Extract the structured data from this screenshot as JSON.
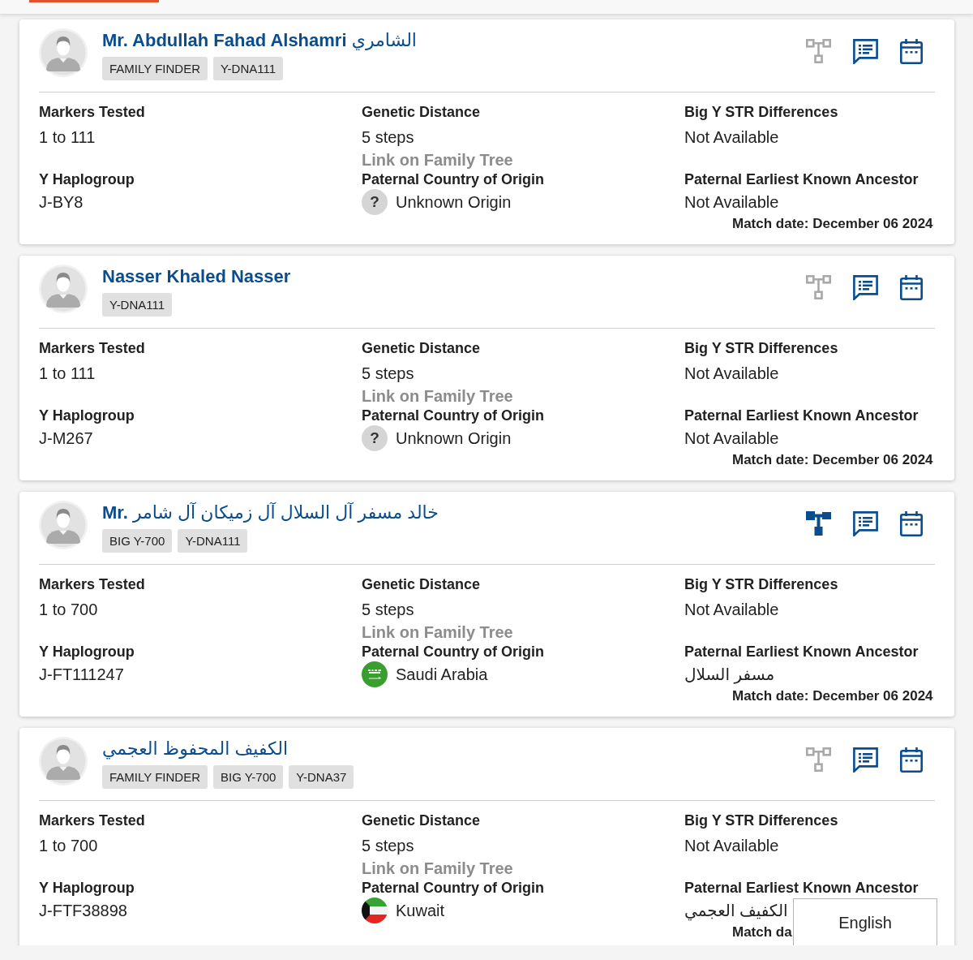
{
  "matches": [
    {
      "name_latin": "Mr. Abdullah Fahad Alshamri",
      "name_arabic": "الشامري",
      "tags": [
        "FAMILY FINDER",
        "Y-DNA111"
      ],
      "tree_available": false,
      "markers_tested": {
        "label": "Markers Tested",
        "value": "1 to 111"
      },
      "genetic_distance": {
        "label": "Genetic Distance",
        "value": "5 steps",
        "link": "Link on Family Tree"
      },
      "big_y_str_differences": {
        "label": "Big Y STR Differences",
        "value": "Not Available"
      },
      "y_haplogroup": {
        "label": "Y Haplogroup",
        "value": "J-BY8"
      },
      "paternal_country_of_origin": {
        "label": "Paternal Country of Origin",
        "value": "Unknown Origin",
        "flag": {
          "kind": "unknown",
          "symbol": "?"
        }
      },
      "paternal_earliest_known_ancestor": {
        "label": "Paternal Earliest Known Ancestor",
        "value": "Not Available"
      },
      "match_date": "Match date: December 06 2024"
    },
    {
      "name_latin": "Nasser Khaled Nasser",
      "tags": [
        "Y-DNA111"
      ],
      "tree_available": false,
      "markers_tested": {
        "label": "Markers Tested",
        "value": "1 to 111"
      },
      "genetic_distance": {
        "label": "Genetic Distance",
        "value": "5 steps",
        "link": "Link on Family Tree"
      },
      "big_y_str_differences": {
        "label": "Big Y STR Differences",
        "value": "Not Available"
      },
      "y_haplogroup": {
        "label": "Y Haplogroup",
        "value": "J-M267"
      },
      "paternal_country_of_origin": {
        "label": "Paternal Country of Origin",
        "value": "Unknown Origin",
        "flag": {
          "kind": "unknown",
          "symbol": "?"
        }
      },
      "paternal_earliest_known_ancestor": {
        "label": "Paternal Earliest Known Ancestor",
        "value": "Not Available"
      },
      "match_date": "Match date: December 06 2024"
    },
    {
      "name_latin": "Mr.",
      "name_arabic": "خالد مسفر آل السلال آل زميكان آل شامر",
      "tags": [
        "BIG Y-700",
        "Y-DNA111"
      ],
      "tree_available": true,
      "markers_tested": {
        "label": "Markers Tested",
        "value": "1 to 700"
      },
      "genetic_distance": {
        "label": "Genetic Distance",
        "value": "5 steps",
        "link": "Link on Family Tree"
      },
      "big_y_str_differences": {
        "label": "Big Y STR Differences",
        "value": "Not Available"
      },
      "y_haplogroup": {
        "label": "Y Haplogroup",
        "value": "J-FT111247"
      },
      "paternal_country_of_origin": {
        "label": "Paternal Country of Origin",
        "value": "Saudi Arabia",
        "flag": {
          "kind": "saudi_arabia"
        }
      },
      "paternal_earliest_known_ancestor": {
        "label": "Paternal Earliest Known Ancestor",
        "value": "مسفر السلال"
      },
      "match_date": "Match date: December 06 2024"
    },
    {
      "name_arabic": "الكفيف المحفوظ العجمي",
      "tags": [
        "FAMILY FINDER",
        "BIG Y-700",
        "Y-DNA37"
      ],
      "tree_available": false,
      "markers_tested": {
        "label": "Markers Tested",
        "value": "1 to 700"
      },
      "genetic_distance": {
        "label": "Genetic Distance",
        "value": "5 steps",
        "link": "Link on Family Tree"
      },
      "big_y_str_differences": {
        "label": "Big Y STR Differences",
        "value": "Not Available"
      },
      "y_haplogroup": {
        "label": "Y Haplogroup",
        "value": "J-FTF38898"
      },
      "paternal_country_of_origin": {
        "label": "Paternal Country of Origin",
        "value": "Kuwait",
        "flag": {
          "kind": "kuwait"
        }
      },
      "paternal_earliest_known_ancestor": {
        "label": "Paternal Earliest Known Ancestor",
        "value": "الكفيف العجمي"
      },
      "match_date": "Match da"
    }
  ],
  "language_menu": {
    "options": [
      {
        "label": "English"
      }
    ]
  }
}
